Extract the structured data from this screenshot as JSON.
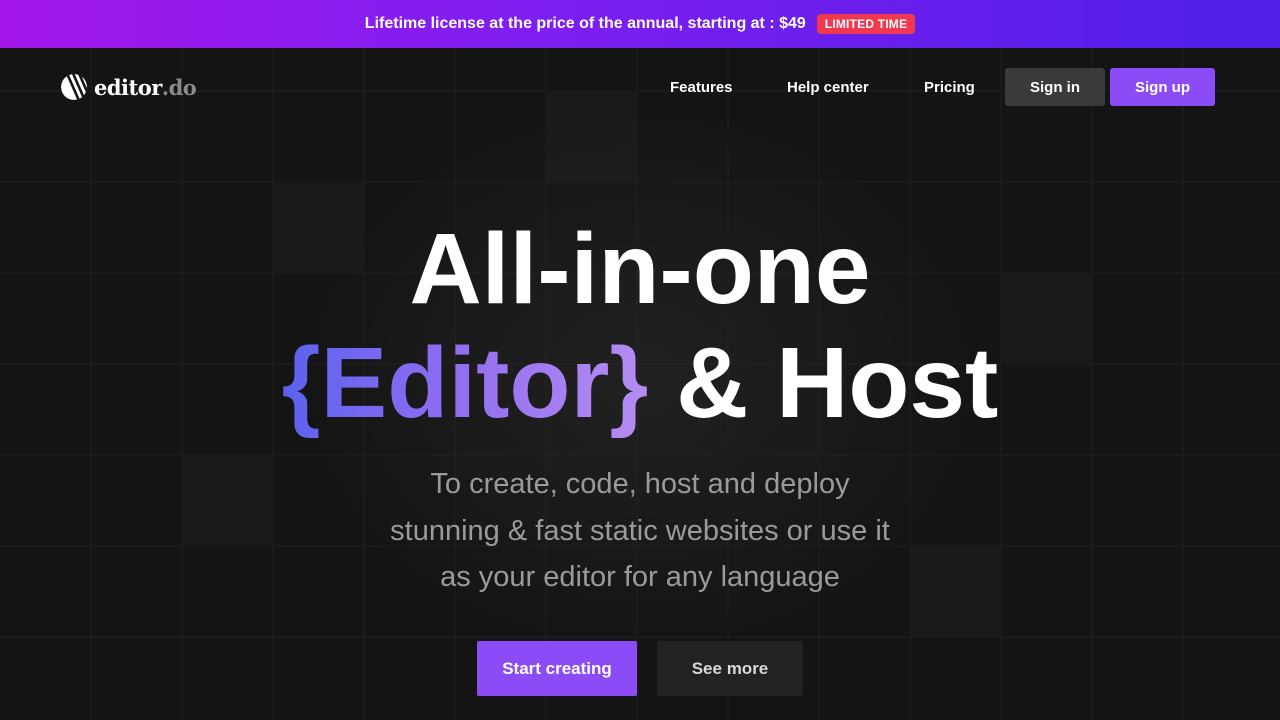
{
  "promo": {
    "text": "Lifetime license at the price of the annual, starting at : $49",
    "badge": "LIMITED TIME"
  },
  "brand": {
    "name": "editor",
    "tld": ".do",
    "logo_icon": "slanted-stripes-logo-icon"
  },
  "nav": {
    "features": "Features",
    "help_center": "Help center",
    "pricing": "Pricing",
    "sign_in": "Sign in",
    "sign_up": "Sign up"
  },
  "hero": {
    "title_line1": "All-in-one",
    "title_accent": "{Editor}",
    "title_rest": " & Host",
    "subtitle_lines": [
      "To create, code, host and deploy",
      "stunning & fast static websites or use it",
      "as your editor for any language"
    ],
    "cta_primary": "Start creating",
    "cta_secondary": "See more"
  },
  "colors": {
    "accent": "#8b4cf7",
    "background": "#141414",
    "badge": "#f0384f",
    "promo_gradient_start": "#a216ea",
    "promo_gradient_end": "#4f1ee8"
  }
}
